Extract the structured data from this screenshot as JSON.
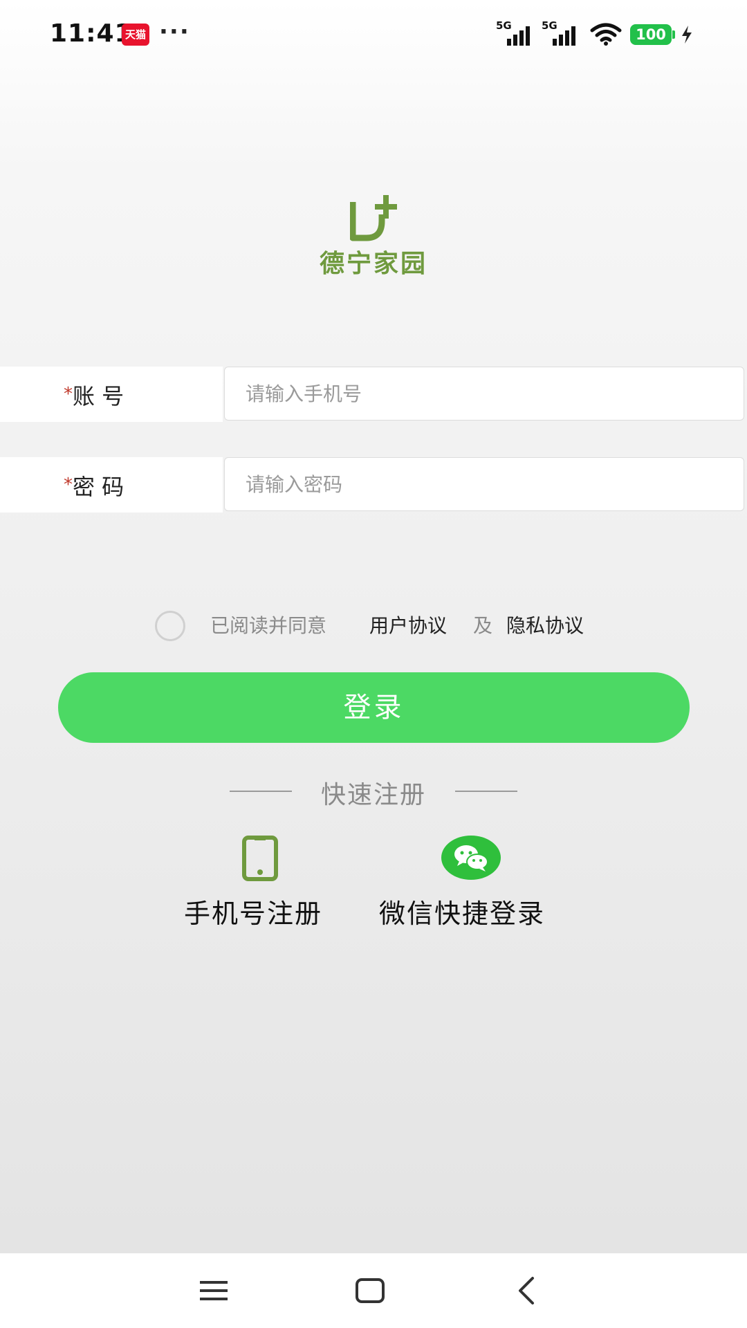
{
  "status_bar": {
    "time": "11:41",
    "app_badge": "天猫",
    "more": "···",
    "signal_1_label": "5G",
    "signal_2_label": "5G",
    "battery": "100",
    "icons": [
      "tmall-badge-icon",
      "signal-icon",
      "wifi-icon",
      "battery-icon",
      "charging-icon"
    ]
  },
  "logo": {
    "text": "德宁家园",
    "icon": "logo-mark-icon",
    "color": "#6f9a3e"
  },
  "form": {
    "required_mark": "*",
    "account_label": "账 号",
    "account_placeholder": "请输入手机号",
    "account_value": "",
    "password_label": "密 码",
    "password_placeholder": "请输入密码",
    "password_value": ""
  },
  "agreement": {
    "checked": false,
    "prefix": "已阅读并同意",
    "user_agreement": "用户协议",
    "and": "及",
    "privacy_agreement": "隐私协议"
  },
  "login_button": {
    "label": "登录",
    "color": "#4cd964"
  },
  "quick_register": {
    "title": "快速注册",
    "phone_label": "手机号注册",
    "phone_icon": "phone-icon",
    "wechat_label": "微信快捷登录",
    "wechat_icon": "wechat-icon",
    "wechat_color": "#2fbf3c"
  },
  "nav_bar": {
    "icons": [
      "menu-icon",
      "home-icon",
      "back-icon"
    ]
  }
}
